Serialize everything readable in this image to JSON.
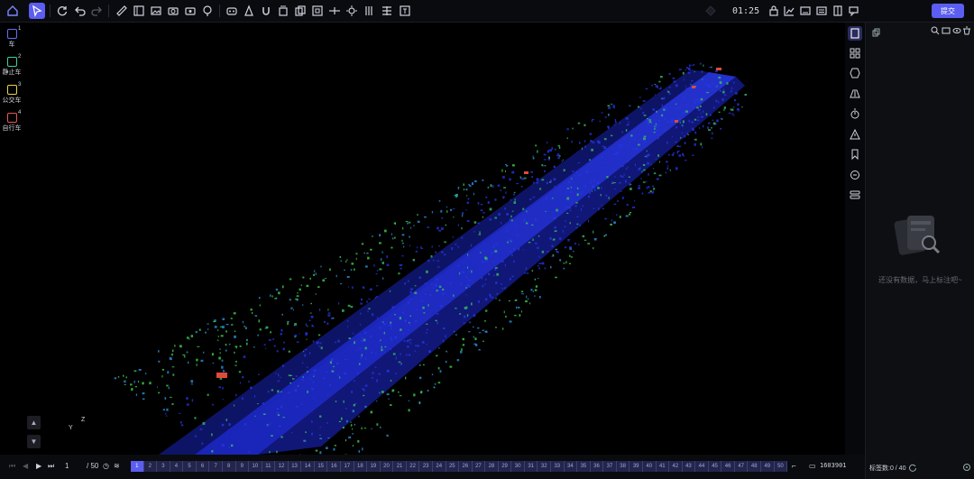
{
  "toolbar": {
    "time": "01:25",
    "submit_label": "提交",
    "icons": [
      "home-icon",
      "select-pointer-icon",
      "refresh-icon",
      "undo-icon",
      "redo-icon",
      "ruler-icon",
      "panel-icon",
      "image-icon",
      "camera-icon",
      "camera-alt-icon",
      "tree-icon",
      "robot-icon",
      "cone-icon",
      "magnet-icon",
      "rotate-box-icon",
      "box-copy-icon",
      "box-icon",
      "fit-icon",
      "sun-icon",
      "axis-icon",
      "align-icon",
      "text-box-icon",
      "location-icon",
      "lock-icon",
      "chart-icon",
      "keyboard-icon",
      "split-view-icon",
      "chat-icon"
    ]
  },
  "classes": [
    {
      "num": "1",
      "label": "车",
      "color": "#6b6cf5"
    },
    {
      "num": "2",
      "label": "静止车",
      "color": "#3fd0a5"
    },
    {
      "num": "3",
      "label": "公交车",
      "color": "#e8d64a"
    },
    {
      "num": "4",
      "label": "自行车",
      "color": "#e85656"
    }
  ],
  "viewer": {
    "axis_x": "Y",
    "axis_z": "Z"
  },
  "right_tools": [
    "bookmark-book-icon",
    "grid-icon",
    "hexagon-icon",
    "road-icon",
    "timer-icon",
    "warning-icon",
    "flag-icon",
    "comment-icon",
    "layers-icon"
  ],
  "panel": {
    "empty_text": "还没有数据，马上标注吧~",
    "count_label": "标签数:0 / 40"
  },
  "bottom": {
    "current_frame": "1",
    "total_frames": "/ 50",
    "frame_id": "1603901",
    "frames": [
      "1",
      "2",
      "3",
      "4",
      "5",
      "6",
      "7",
      "8",
      "9",
      "10",
      "11",
      "12",
      "13",
      "14",
      "15",
      "16",
      "17",
      "18",
      "19",
      "20",
      "21",
      "22",
      "23",
      "24",
      "25",
      "26",
      "27",
      "28",
      "29",
      "30",
      "31",
      "32",
      "33",
      "34",
      "35",
      "36",
      "37",
      "38",
      "39",
      "40",
      "41",
      "42",
      "43",
      "44",
      "45",
      "46",
      "47",
      "48",
      "49",
      "50"
    ]
  }
}
